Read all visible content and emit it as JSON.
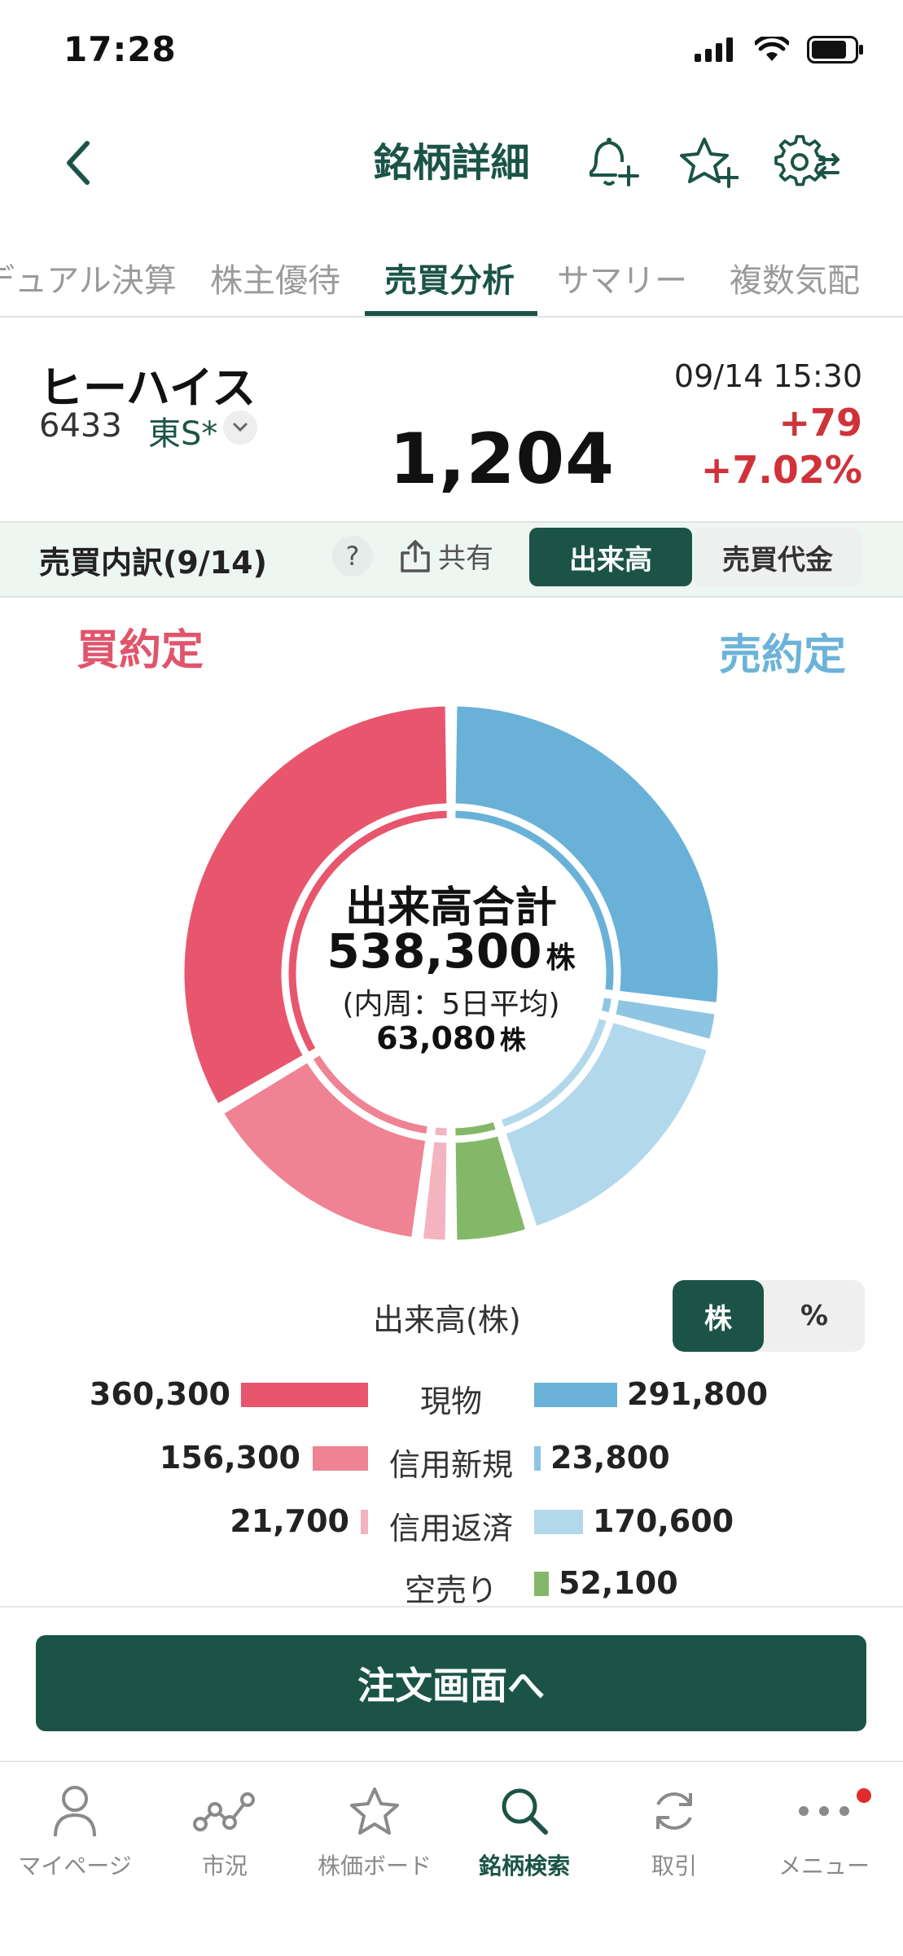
{
  "status": {
    "time": "17:28"
  },
  "header": {
    "title": "銘柄詳細"
  },
  "tabs": [
    {
      "label": "デュアル決算"
    },
    {
      "label": "株主優待"
    },
    {
      "label": "売買分析"
    },
    {
      "label": "サマリー"
    },
    {
      "label": "複数気配"
    }
  ],
  "stock": {
    "name": "ヒーハイス",
    "code": "6433",
    "market": "東S*",
    "price": "1,204",
    "datetime": "09/14 15:30",
    "change": "+79",
    "change_pct": "+7.02%"
  },
  "toolbar": {
    "title": "売買内訳(9/14)",
    "help": "?",
    "share": "共有",
    "seg_volume": "出来高",
    "seg_value": "売買代金"
  },
  "chart": {
    "buy_label": "買約定",
    "sell_label": "売約定",
    "center_title": "出来高合計",
    "center_total": "538,300",
    "center_unit": "株",
    "center_inner_label": "(内周：5日平均)",
    "center_avg": "63,080",
    "center_avg_unit": "株",
    "colors": {
      "buy_spot": "#e8566e",
      "buy_margin_new": "#ef8393",
      "buy_margin_close": "#f4b4bf",
      "sell_spot": "#6ab1d8",
      "sell_margin_new": "#8ec5e3",
      "sell_margin_close": "#b2d8ec",
      "short": "#84b869"
    }
  },
  "chart_data": {
    "type": "pie",
    "title": "出来高合計",
    "outer": [
      {
        "side": "sell",
        "name": "現物",
        "value": 291800
      },
      {
        "side": "sell",
        "name": "信用新規",
        "value": 23800
      },
      {
        "side": "sell",
        "name": "信用返済",
        "value": 170600
      },
      {
        "side": "sell",
        "name": "空売り",
        "value": 52100
      },
      {
        "side": "buy",
        "name": "信用返済",
        "value": 21700
      },
      {
        "side": "buy",
        "name": "信用新規",
        "value": 156300
      },
      {
        "side": "buy",
        "name": "現物",
        "value": 360300
      }
    ],
    "total": 538300,
    "inner_avg_5d": 63080
  },
  "volume_table": {
    "title": "出来高(株)",
    "unit_share": "株",
    "unit_pct": "%",
    "rows": [
      {
        "label": "現物",
        "buy": "360,300",
        "sell": "291,800",
        "buy_value": 360300,
        "sell_value": 291800
      },
      {
        "label": "信用新規",
        "buy": "156,300",
        "sell": "23,800",
        "buy_value": 156300,
        "sell_value": 23800
      },
      {
        "label": "信用返済",
        "buy": "21,700",
        "sell": "170,600",
        "buy_value": 21700,
        "sell_value": 170600
      },
      {
        "label": "空売り",
        "buy": "",
        "sell": "52,100",
        "buy_value": 0,
        "sell_value": 52100
      }
    ]
  },
  "order_button": {
    "label": "注文画面へ"
  },
  "nav": [
    {
      "label": "マイページ",
      "icon": "person-icon"
    },
    {
      "label": "市況",
      "icon": "chart-nodes-icon"
    },
    {
      "label": "株価ボード",
      "icon": "star-icon"
    },
    {
      "label": "銘柄検索",
      "icon": "search-icon"
    },
    {
      "label": "取引",
      "icon": "refresh-icon"
    },
    {
      "label": "メニュー",
      "icon": "more-icon"
    }
  ]
}
